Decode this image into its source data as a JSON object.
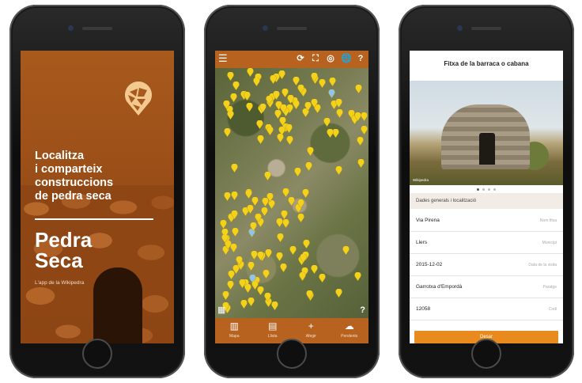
{
  "phone1": {
    "tagline": "Localitza\ni comparteix\nconstruccions\nde pedra seca",
    "brand": "Pedra\nSeca",
    "subtitle": "L'app de la Wikipedra"
  },
  "phone2": {
    "menu_icon": "menu-icon",
    "tools": [
      "refresh-icon",
      "fullscreen-icon",
      "locate-icon",
      "globe-icon",
      "help-icon"
    ],
    "tabs": [
      {
        "icon": "map-icon",
        "label": "Mapa"
      },
      {
        "icon": "list-icon",
        "label": "Llista"
      },
      {
        "icon": "add-icon",
        "label": "Afegir"
      },
      {
        "icon": "upload-icon",
        "label": "Pendents"
      }
    ]
  },
  "phone3": {
    "title": "Fitxa de la barraca o cabana",
    "photo_credit": "Wikipedra",
    "section": "Dades generals i localització",
    "rows": [
      {
        "value": "Via Pirena",
        "key": "Nom fitxa"
      },
      {
        "value": "Llers",
        "key": "Municipi"
      },
      {
        "value": "2015-12-02",
        "key": "Data de la visita"
      },
      {
        "value": "Garrotxa d'Empordà",
        "key": "Paratge"
      },
      {
        "value": "12058",
        "key": "Codi"
      }
    ],
    "save_label": "Desar"
  },
  "colors": {
    "accent": "#b8621f",
    "button": "#e88a1e",
    "pin": "#f4d21c"
  }
}
